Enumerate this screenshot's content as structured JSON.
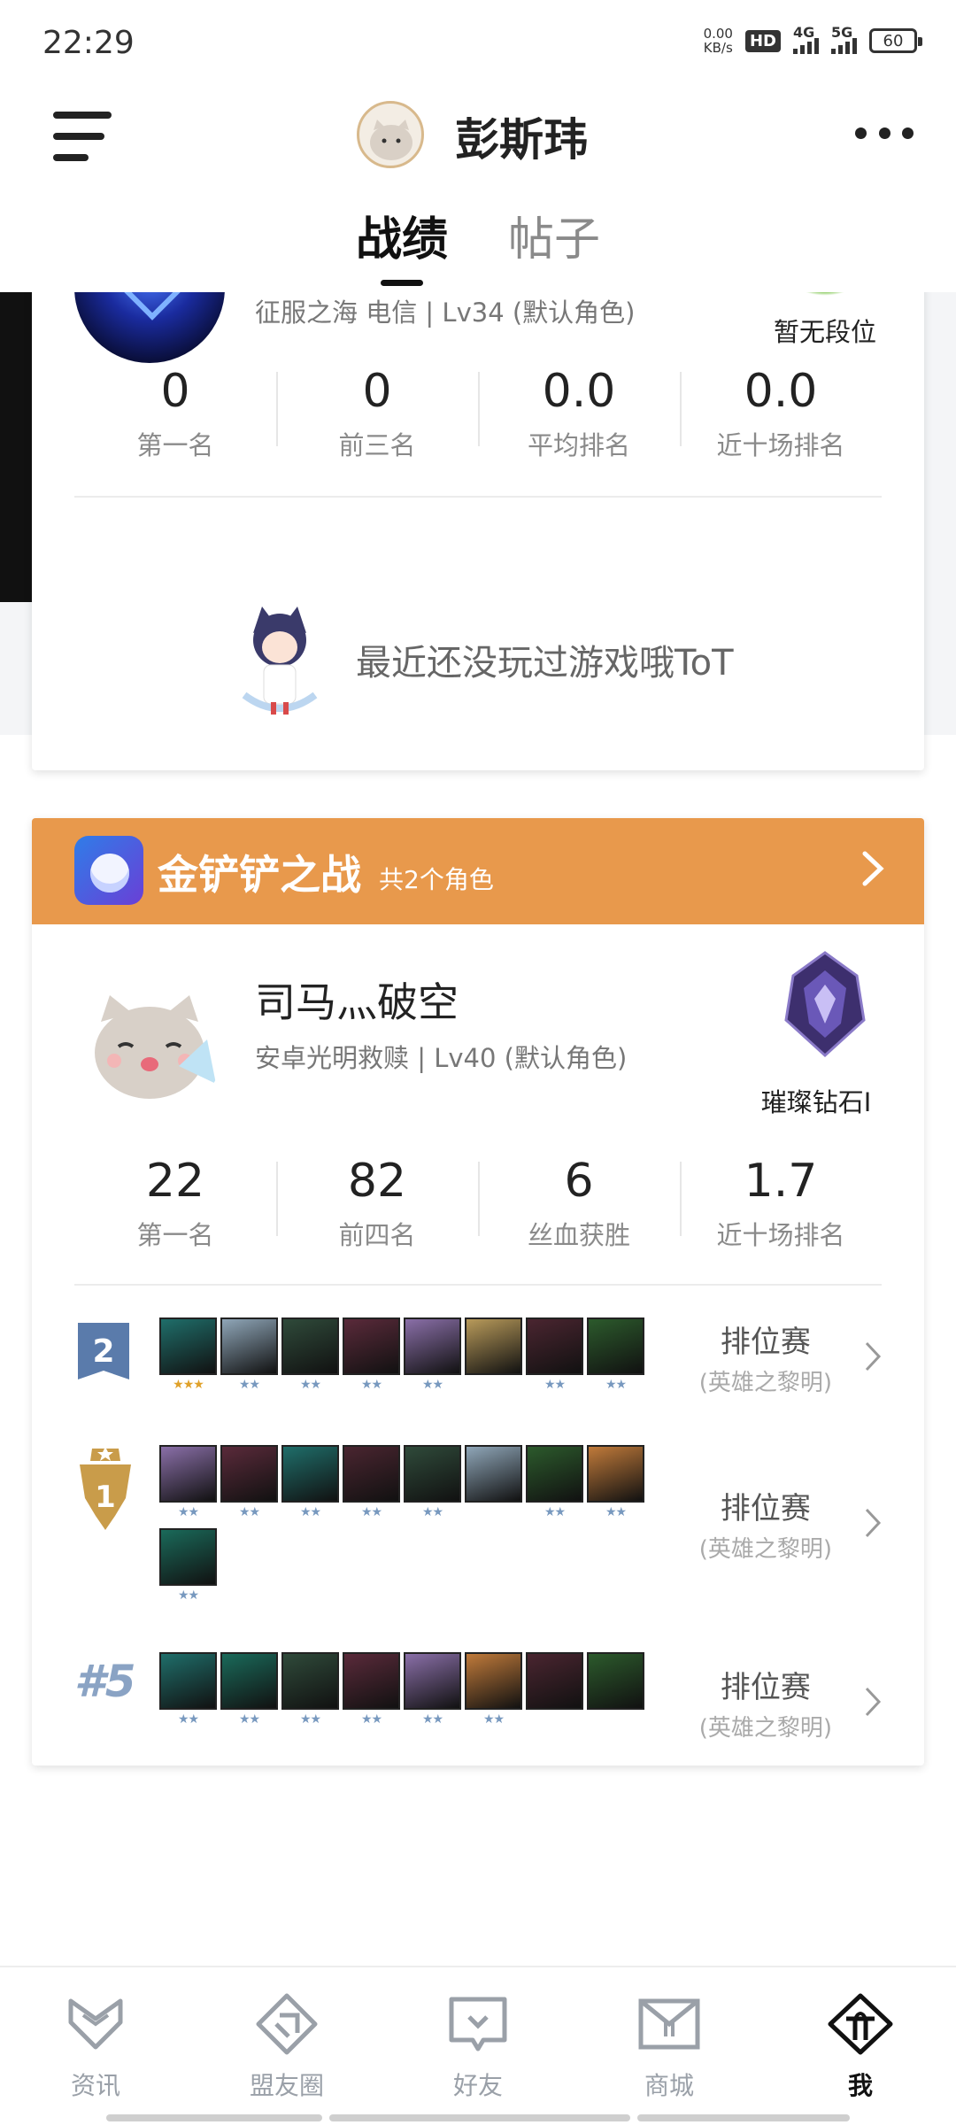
{
  "status_bar": {
    "time": "22:29",
    "net_speed_value": "0.00",
    "net_speed_unit": "KB/s",
    "hd_label": "HD",
    "sim1_label": "4G",
    "sim2_label": "5G",
    "battery_level": "60"
  },
  "header": {
    "profile_name": "彭斯玮",
    "tabs": [
      {
        "label": "战绩",
        "active": true
      },
      {
        "label": "帖子",
        "active": false
      }
    ]
  },
  "lol_card": {
    "subline": "征服之海 电信 | Lv34 (默认角色)",
    "rank_label": "暂无段位",
    "stats": [
      {
        "value": "0",
        "label": "第一名"
      },
      {
        "value": "0",
        "label": "前三名"
      },
      {
        "value": "0.0",
        "label": "平均排名"
      },
      {
        "value": "0.0",
        "label": "近十场排名"
      }
    ],
    "empty_message": "最近还没玩过游戏哦ToT"
  },
  "tft_card": {
    "title": "金铲铲之战",
    "role_count": "共2个角色",
    "header_color": "#e8994c",
    "character_name": "司马灬破空",
    "subline": "安卓光明救赎 | Lv40 (默认角色)",
    "rank_label": "璀璨钻石I",
    "stats": [
      {
        "value": "22",
        "label": "第一名"
      },
      {
        "value": "82",
        "label": "前四名"
      },
      {
        "value": "6",
        "label": "丝血获胜"
      },
      {
        "value": "1.7",
        "label": "近十场排名"
      }
    ],
    "matches": [
      {
        "placement": "2",
        "mode": "排位赛",
        "mode_sub": "(英雄之黎明)",
        "champions": [
          {
            "stars": 3,
            "color": "#1f6e6a"
          },
          {
            "stars": 2,
            "color": "#8fa6b8"
          },
          {
            "stars": 2,
            "color": "#2f4a3a"
          },
          {
            "stars": 2,
            "color": "#5a2a3a"
          },
          {
            "stars": 2,
            "color": "#8a6fa8"
          },
          {
            "stars": 0,
            "color": "#b89a5a"
          },
          {
            "stars": 2,
            "color": "#4a2530"
          },
          {
            "stars": 2,
            "color": "#2c5a2c"
          }
        ]
      },
      {
        "placement": "1",
        "mode": "排位赛",
        "mode_sub": "(英雄之黎明)",
        "champions": [
          {
            "stars": 2,
            "color": "#8a6fa8"
          },
          {
            "stars": 2,
            "color": "#5a2a3a"
          },
          {
            "stars": 2,
            "color": "#1f6e6a"
          },
          {
            "stars": 2,
            "color": "#4a2530"
          },
          {
            "stars": 2,
            "color": "#2f4a3a"
          },
          {
            "stars": 0,
            "color": "#8fa6b8"
          },
          {
            "stars": 2,
            "color": "#2c5a2c"
          },
          {
            "stars": 2,
            "color": "#c07a3a"
          },
          {
            "stars": 2,
            "color": "#1a6a5a"
          }
        ]
      },
      {
        "placement": "#5",
        "mode": "排位赛",
        "mode_sub": "(英雄之黎明)",
        "champions": [
          {
            "stars": 2,
            "color": "#1f6e6a"
          },
          {
            "stars": 2,
            "color": "#1a6a5a"
          },
          {
            "stars": 2,
            "color": "#2f4a3a"
          },
          {
            "stars": 2,
            "color": "#5a2a3a"
          },
          {
            "stars": 2,
            "color": "#8a6fa8"
          },
          {
            "stars": 2,
            "color": "#c07a3a"
          },
          {
            "stars": 0,
            "color": "#4a2530"
          },
          {
            "stars": 0,
            "color": "#2c5a2c"
          }
        ]
      }
    ]
  },
  "bottom_nav": [
    {
      "label": "资讯",
      "icon": "news-icon",
      "active": false
    },
    {
      "label": "盟友圈",
      "icon": "community-icon",
      "active": false
    },
    {
      "label": "好友",
      "icon": "friends-icon",
      "active": false
    },
    {
      "label": "商城",
      "icon": "shop-icon",
      "active": false
    },
    {
      "label": "我",
      "icon": "me-icon",
      "active": true
    }
  ]
}
